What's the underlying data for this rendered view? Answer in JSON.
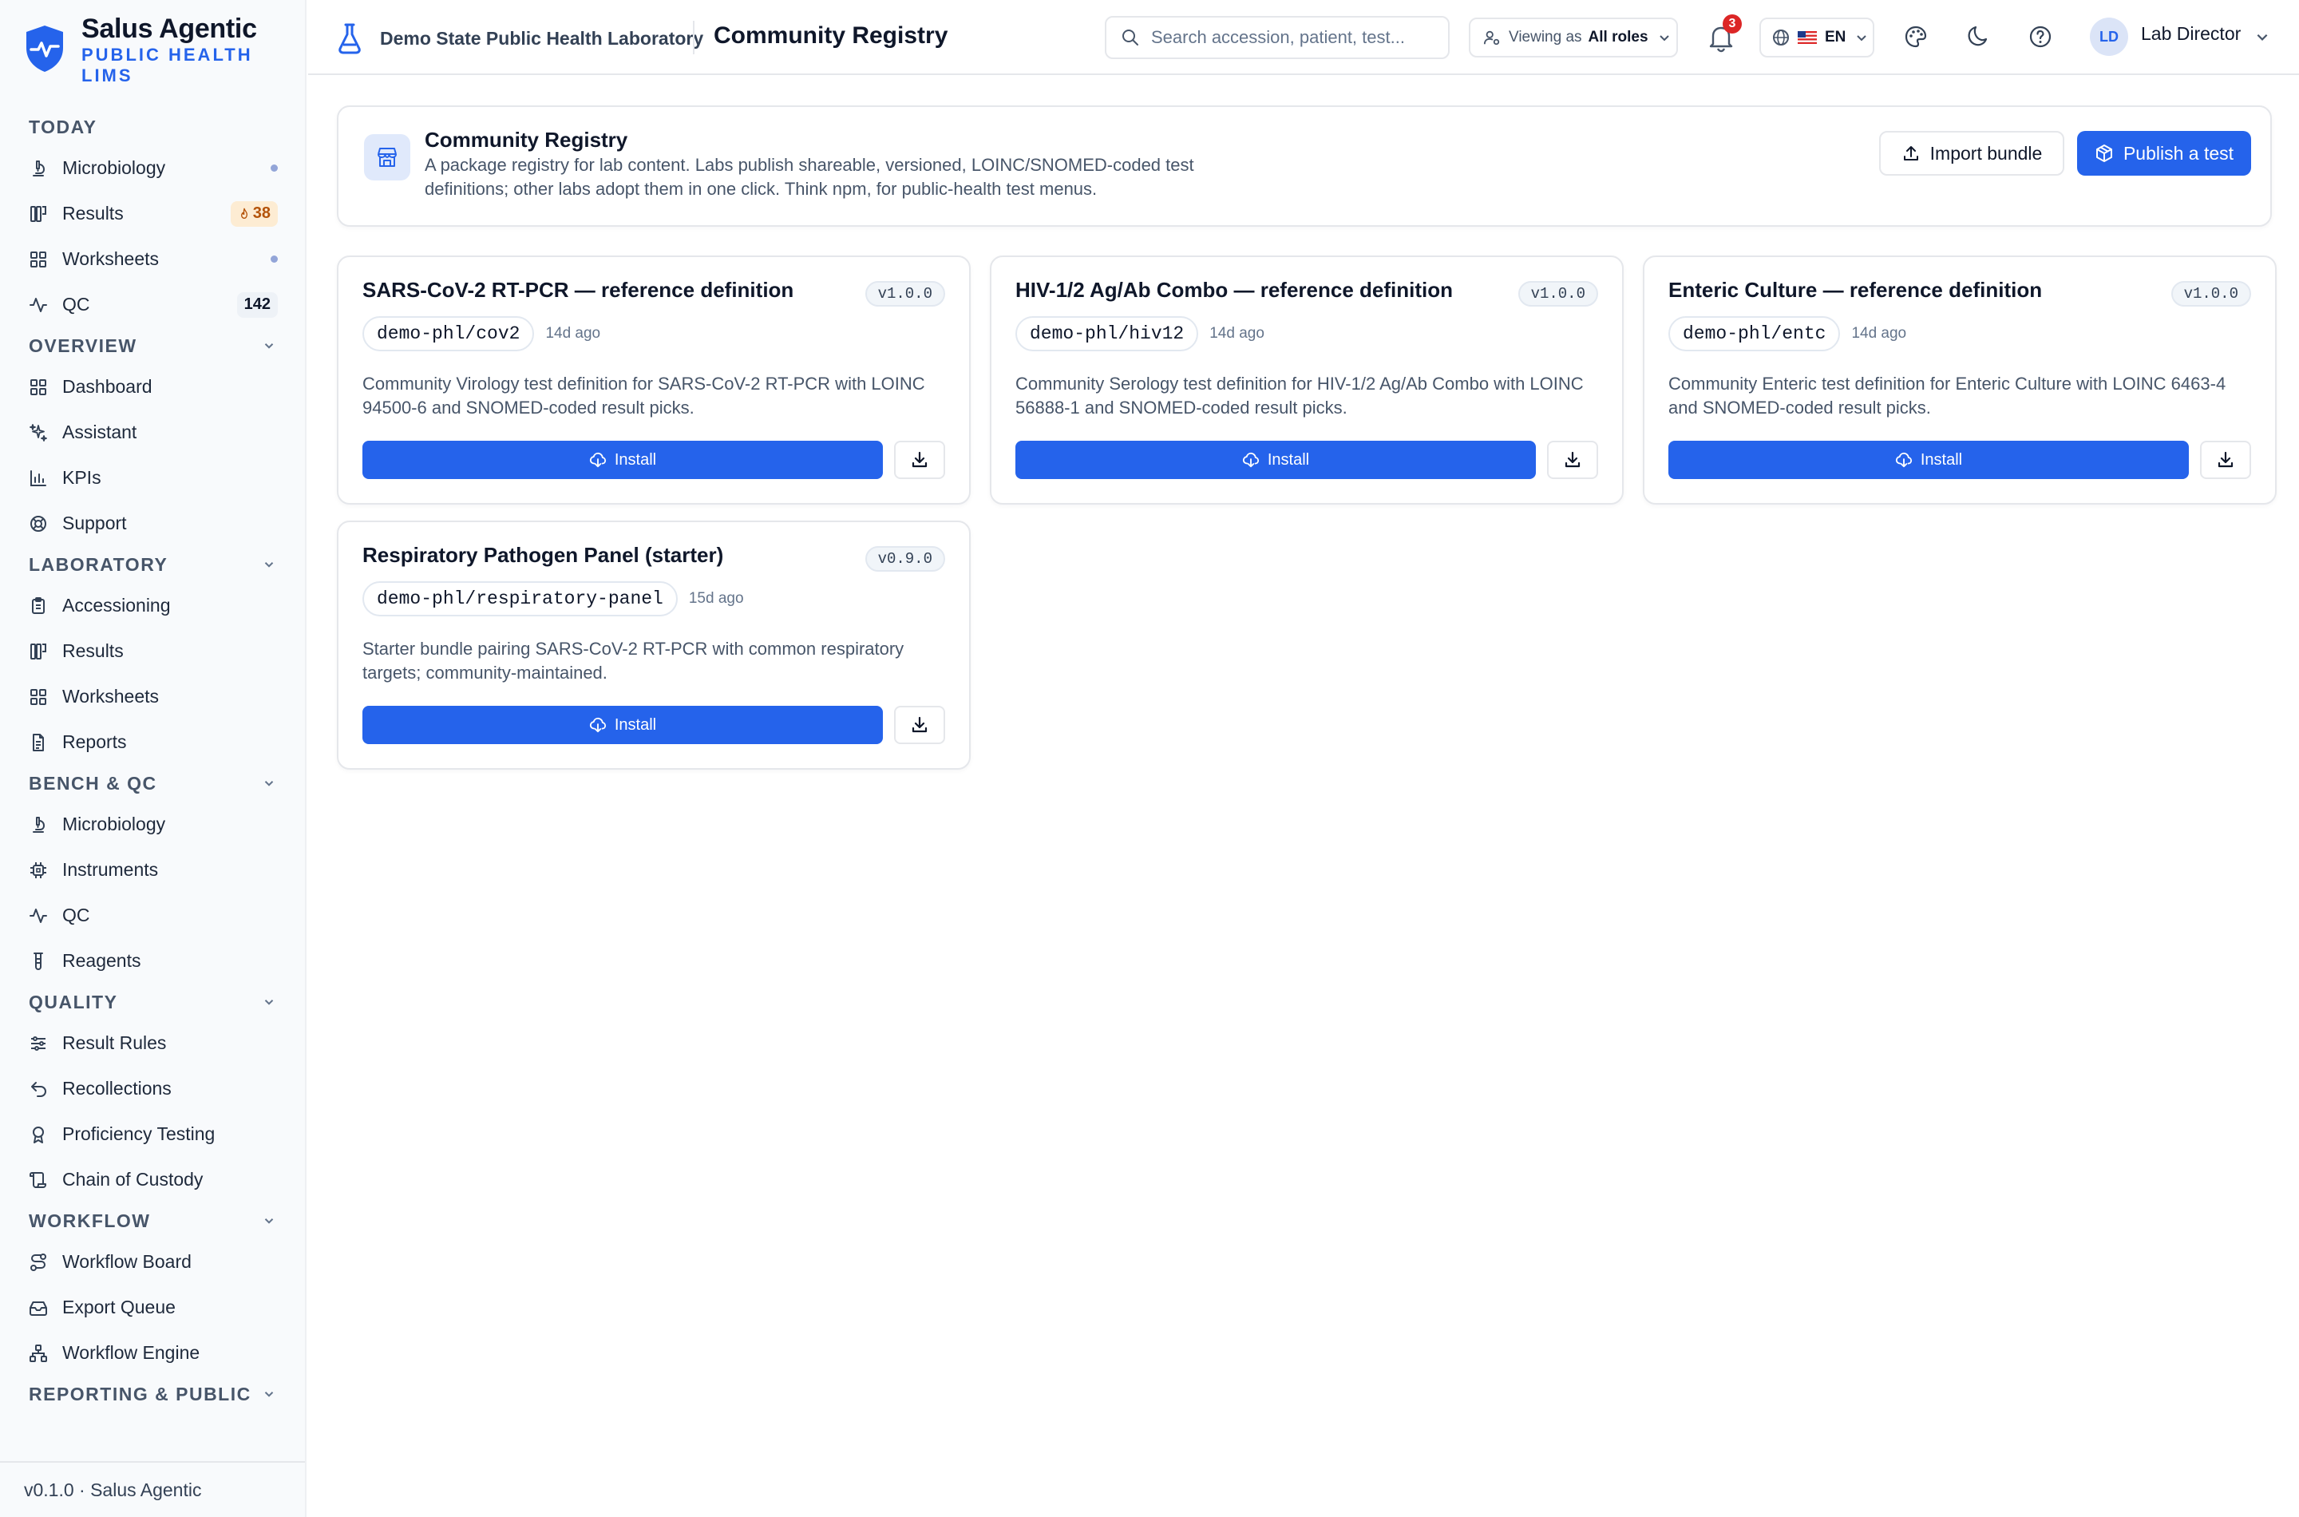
{
  "brand": {
    "name": "Salus Agentic",
    "subtitle": "PUBLIC HEALTH LIMS",
    "accent_color": "#2563eb"
  },
  "sidebar": {
    "sections": [
      {
        "label": "TODAY",
        "collapsible": false,
        "items": [
          {
            "label": "Microbiology",
            "icon": "microscope-icon",
            "dot": true
          },
          {
            "label": "Results",
            "icon": "columns-icon",
            "badge": "38",
            "badge_icon": "flame-icon",
            "badge_style": "warn"
          },
          {
            "label": "Worksheets",
            "icon": "grid-icon",
            "dot": true
          },
          {
            "label": "QC",
            "icon": "activity-icon",
            "badge": "142",
            "badge_style": "count"
          }
        ]
      },
      {
        "label": "OVERVIEW",
        "collapsible": true,
        "items": [
          {
            "label": "Dashboard",
            "icon": "grid-icon"
          },
          {
            "label": "Assistant",
            "icon": "sparkles-icon"
          },
          {
            "label": "KPIs",
            "icon": "bar-chart-icon"
          },
          {
            "label": "Support",
            "icon": "lifebuoy-icon"
          }
        ]
      },
      {
        "label": "LABORATORY",
        "collapsible": true,
        "items": [
          {
            "label": "Accessioning",
            "icon": "clipboard-icon"
          },
          {
            "label": "Results",
            "icon": "columns-icon"
          },
          {
            "label": "Worksheets",
            "icon": "grid-icon"
          },
          {
            "label": "Reports",
            "icon": "file-text-icon"
          }
        ]
      },
      {
        "label": "BENCH & QC",
        "collapsible": true,
        "items": [
          {
            "label": "Microbiology",
            "icon": "microscope-icon"
          },
          {
            "label": "Instruments",
            "icon": "cpu-icon"
          },
          {
            "label": "QC",
            "icon": "activity-icon"
          },
          {
            "label": "Reagents",
            "icon": "test-tube-icon"
          }
        ]
      },
      {
        "label": "QUALITY",
        "collapsible": true,
        "items": [
          {
            "label": "Result Rules",
            "icon": "sliders-icon"
          },
          {
            "label": "Recollections",
            "icon": "undo-icon"
          },
          {
            "label": "Proficiency Testing",
            "icon": "award-icon"
          },
          {
            "label": "Chain of Custody",
            "icon": "scroll-icon"
          }
        ]
      },
      {
        "label": "WORKFLOW",
        "collapsible": true,
        "items": [
          {
            "label": "Workflow Board",
            "icon": "route-icon"
          },
          {
            "label": "Export Queue",
            "icon": "inbox-icon"
          },
          {
            "label": "Workflow Engine",
            "icon": "network-icon"
          }
        ]
      },
      {
        "label": "REPORTING & PUBLIC",
        "collapsible": true,
        "items": []
      }
    ],
    "footer": "v0.1.0 · Salus Agentic"
  },
  "topbar": {
    "lab_name": "Demo State Public Health Laboratory",
    "page_title": "Community Registry",
    "search_placeholder": "Search accession, patient, test...",
    "viewing_prefix": "Viewing as",
    "viewing_value": "All roles",
    "notifications_count": "3",
    "language": "EN",
    "user_initials": "LD",
    "user_name": "Lab Director"
  },
  "hero": {
    "title": "Community Registry",
    "description": "A package registry for lab content. Labs publish shareable, versioned, LOINC/SNOMED-coded test definitions; other labs adopt them in one click. Think npm, for public-health test menus.",
    "import_label": "Import bundle",
    "publish_label": "Publish a test"
  },
  "packages": [
    {
      "title": "SARS-CoV-2 RT-PCR — reference definition",
      "version": "v1.0.0",
      "slug": "demo-phl/cov2",
      "age": "14d ago",
      "description": "Community Virology test definition for SARS-CoV-2 RT-PCR with LOINC 94500-6 and SNOMED-coded result picks.",
      "install_label": "Install"
    },
    {
      "title": "HIV-1/2 Ag/Ab Combo — reference definition",
      "version": "v1.0.0",
      "slug": "demo-phl/hiv12",
      "age": "14d ago",
      "description": "Community Serology test definition for HIV-1/2 Ag/Ab Combo with LOINC 56888-1 and SNOMED-coded result picks.",
      "install_label": "Install"
    },
    {
      "title": "Enteric Culture — reference definition",
      "version": "v1.0.0",
      "slug": "demo-phl/entc",
      "age": "14d ago",
      "description": "Community Enteric test definition for Enteric Culture with LOINC 6463-4 and SNOMED-coded result picks.",
      "install_label": "Install"
    },
    {
      "title": "Respiratory Pathogen Panel (starter)",
      "version": "v0.9.0",
      "slug": "demo-phl/respiratory-panel",
      "age": "15d ago",
      "description": "Starter bundle pairing SARS-CoV-2 RT-PCR with common respiratory targets; community-maintained.",
      "install_label": "Install"
    }
  ]
}
